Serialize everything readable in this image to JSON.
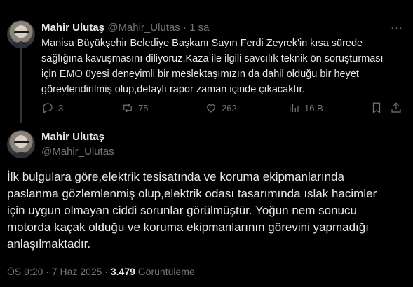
{
  "tweet1": {
    "author_name": "Mahir Ulutaş",
    "handle": "@Mahir_Ulutas",
    "separator": "·",
    "time": "1 sa",
    "more": "···",
    "text": "Manisa Büyükşehir Belediye Başkanı Sayın Ferdi Zeyrek'in kısa sürede\nsağlığına kavuşmasını diliyoruz.Kaza ile ilgili savcılık teknik ön soruşturması\niçin EMO üyesi deneyimli bir meslektaşımızın da dahil olduğu bir heyet\ngörevlendirilmiş olup,detaylı rapor zaman içinde çıkacaktır.",
    "replies": "3",
    "reposts": "75",
    "likes": "262",
    "views": "16 B"
  },
  "tweet2": {
    "author_name": "Mahir Ulutaş",
    "handle": "@Mahir_Ulutas",
    "text": "İlk bulgulara göre,elektrik tesisatında ve koruma ekipmanlarında\npaslanma  gözlemlenmiş olup,elektrik odası tasarımında ıslak hacimler\niçin uygun olmayan ciddi sorunlar görülmüştür. Yoğun nem sonucu\nmotorda kaçak olduğu ve koruma ekipmanlarının görevini yapmadığı\nanlaşılmaktadır.",
    "timestamp": "ÖS 9:20 · 7 Haz 2025 · ",
    "view_count": "3.479",
    "view_label": " Görüntüleme"
  },
  "colors": {
    "background": "#000000",
    "text_primary": "#e7e9ea",
    "text_secondary": "#71767b",
    "thread_line": "#333639"
  },
  "icons": [
    "reply-icon",
    "repost-icon",
    "like-icon",
    "views-icon",
    "bookmark-icon",
    "share-icon",
    "more-icon"
  ]
}
